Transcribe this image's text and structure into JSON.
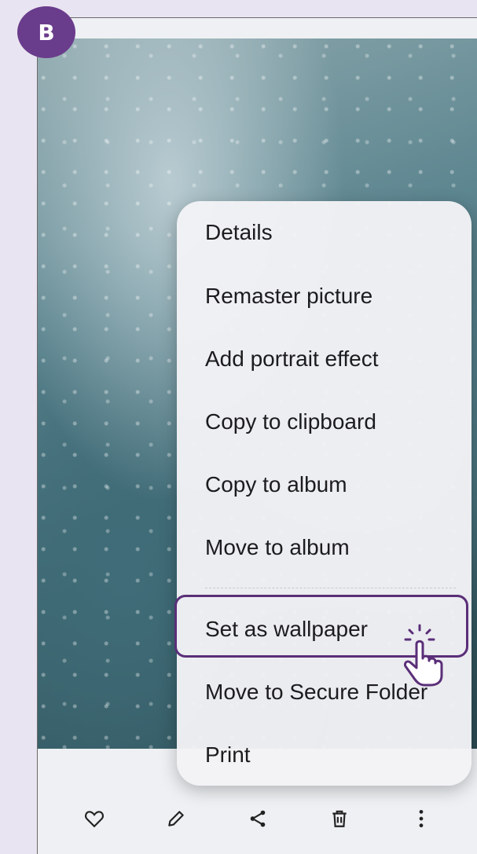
{
  "badge": {
    "label": "B"
  },
  "menu": {
    "items": [
      {
        "label": "Details"
      },
      {
        "label": "Remaster picture"
      },
      {
        "label": "Add portrait effect"
      },
      {
        "label": "Copy to clipboard"
      },
      {
        "label": "Copy to album"
      },
      {
        "label": "Move to album"
      },
      {
        "label": "Set as wallpaper"
      },
      {
        "label": "Move to Secure Folder"
      },
      {
        "label": "Print"
      }
    ],
    "highlighted_item": "Set as wallpaper"
  },
  "toolbar": {
    "icons": [
      "heart-icon",
      "edit-icon",
      "share-icon",
      "delete-icon",
      "more-icon"
    ]
  },
  "colors": {
    "accent": "#5a2e78",
    "badge": "#6a3c8c",
    "background": "#e9e4f1"
  }
}
